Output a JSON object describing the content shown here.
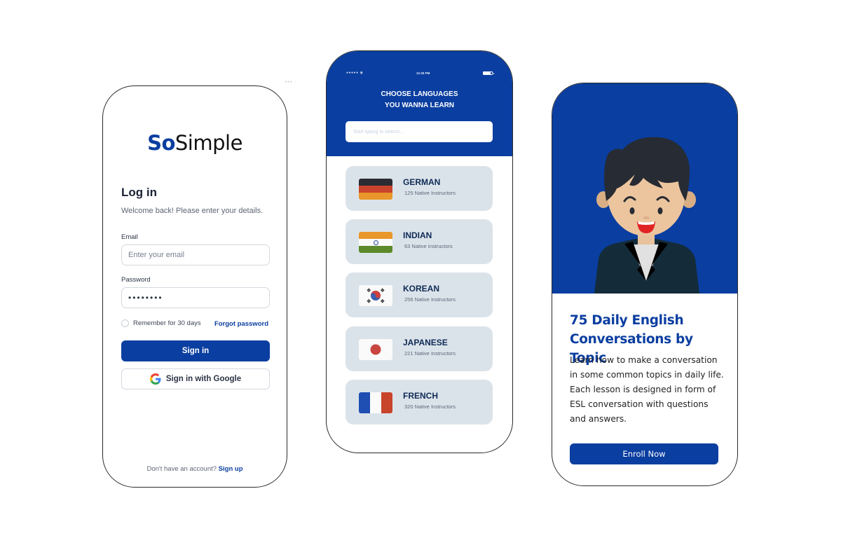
{
  "login": {
    "logo_bold": "So",
    "logo_rest": "Simple",
    "title": "Log in",
    "subtitle": "Welcome back! Please enter your details.",
    "email_label": "Email",
    "email_placeholder": "Enter your email",
    "email_value": "",
    "password_label": "Password",
    "password_value": "••••••••",
    "remember_label": "Remember for 30 days",
    "remember_checked": false,
    "forgot_label": "Forgot password",
    "signin_label": "Sign in",
    "google_label": "Sign in with Google",
    "signup_prompt": "Don't have an account?",
    "signup_link": "Sign up"
  },
  "ornament": "••• ·",
  "languages": {
    "status": {
      "signal": "●●●●● ◉",
      "time": "12:26 PM"
    },
    "title_line1": "CHOOSE LANGUAGES",
    "title_line2": "YOU WANNA LEARN",
    "search_placeholder": "Start typing to search...",
    "items": [
      {
        "name": "GERMAN",
        "count": "125 Native Instructors",
        "flag": "germany-flag"
      },
      {
        "name": "INDIAN",
        "count": "63 Native Instructors",
        "flag": "india-flag"
      },
      {
        "name": "KOREAN",
        "count": "256 Native Instructors",
        "flag": "korea-flag"
      },
      {
        "name": "JAPANESE",
        "count": "221 Native Instructors",
        "flag": "japan-flag"
      },
      {
        "name": "FRENCH",
        "count": "320 Native Instructors",
        "flag": "france-flag"
      }
    ]
  },
  "course": {
    "title": "75 Daily English Conversations by Topic",
    "description": "Learn how to make a conversation in some common topics in daily life. Each lesson is designed in form of ESL conversation with questions and answers.",
    "cta": "Enroll Now"
  },
  "colors": {
    "brand_blue": "#0a3ea0",
    "card_bg": "#dbe3ea",
    "text_dark": "#1a2236"
  }
}
